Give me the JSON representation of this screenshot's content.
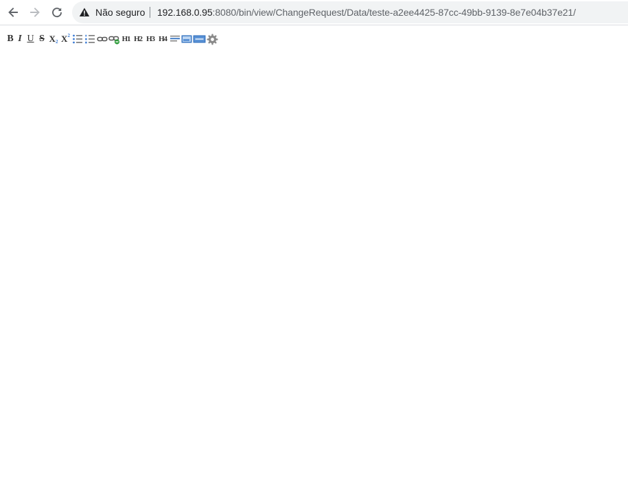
{
  "browser": {
    "security_label": "Não seguro",
    "url_host": "192.168.0.95",
    "url_rest": ":8080/bin/view/ChangeRequest/Data/teste-a2ee4425-87cc-49bb-9139-8e7e04b37e21/"
  },
  "toolbar": {
    "bold": "B",
    "italic": "I",
    "underline": "U",
    "strike": "S",
    "subscript_base": "X",
    "subscript_mark": "2",
    "superscript_base": "X",
    "superscript_mark": "2",
    "h1": "H1",
    "h2": "H2",
    "h3": "H3",
    "h4": "H4"
  },
  "colors": {
    "warning_icon": "#202124",
    "list_blue": "#3a7bd5",
    "link_green": "#2e9b3a",
    "macro_blue": "#3c78c3"
  }
}
